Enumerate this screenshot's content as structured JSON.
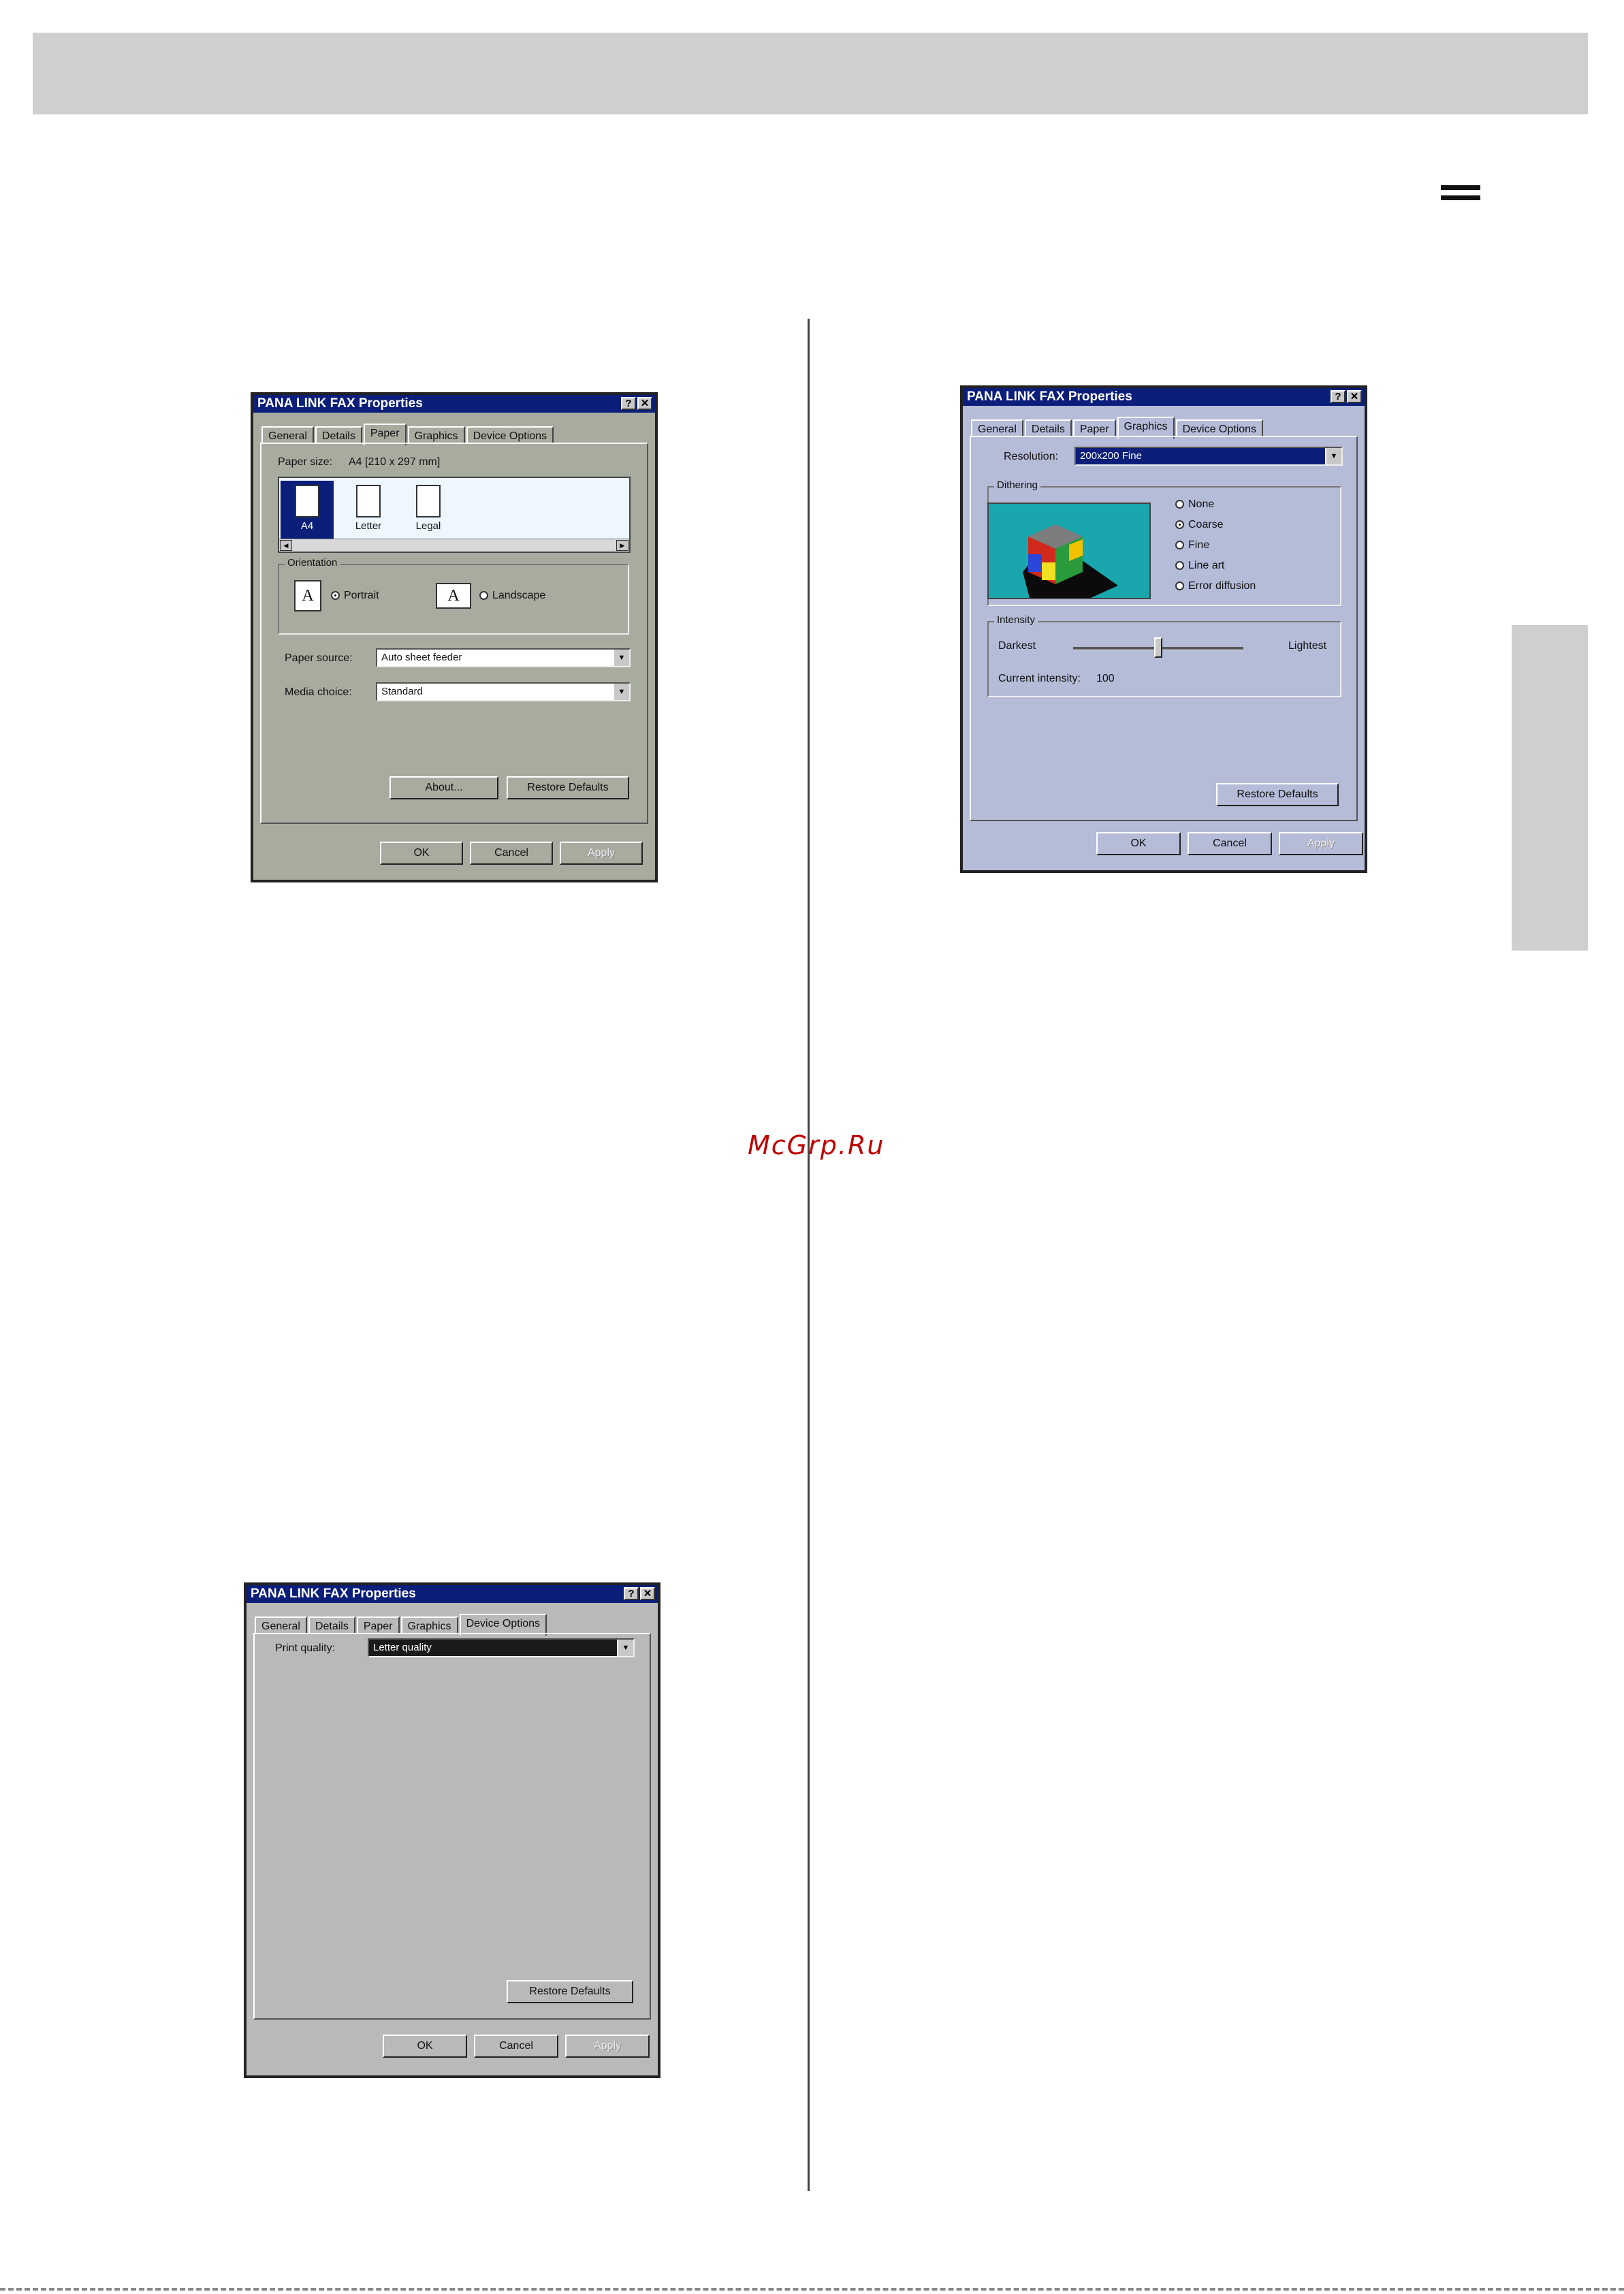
{
  "watermark": "McGrp.Ru",
  "dialog_paper": {
    "title": "PANA LINK FAX Properties",
    "help_btn": "?",
    "close_btn": "✕",
    "tabs": [
      "General",
      "Details",
      "Paper",
      "Graphics",
      "Device Options"
    ],
    "active_tab": "Paper",
    "paper_size_label": "Paper size:",
    "paper_size_value": "A4   [210 x 297 mm]",
    "paper_items": [
      "A4",
      "Letter",
      "Legal"
    ],
    "orientation_label": "Orientation",
    "orientation_portrait": "Portrait",
    "orientation_landscape": "Landscape",
    "orientation_icon_glyph": "A",
    "paper_source_label": "Paper source:",
    "paper_source_value": "Auto sheet feeder",
    "media_choice_label": "Media choice:",
    "media_choice_value": "Standard",
    "about_btn": "About...",
    "restore_btn": "Restore Defaults",
    "ok_btn": "OK",
    "cancel_btn": "Cancel",
    "apply_btn": "Apply"
  },
  "dialog_graphics": {
    "title": "PANA LINK FAX Properties",
    "help_btn": "?",
    "close_btn": "✕",
    "tabs": [
      "General",
      "Details",
      "Paper",
      "Graphics",
      "Device Options"
    ],
    "active_tab": "Graphics",
    "resolution_label": "Resolution:",
    "resolution_value": "200x200 Fine",
    "dithering_label": "Dithering",
    "dither_options": [
      "None",
      "Coarse",
      "Fine",
      "Line art",
      "Error diffusion"
    ],
    "dither_selected": "Coarse",
    "intensity_label": "Intensity",
    "darkest_label": "Darkest",
    "lightest_label": "Lightest",
    "intensity_value": 100,
    "intensity_min": 0,
    "intensity_max": 200,
    "current_intensity_label": "Current intensity:",
    "current_intensity_value": "100",
    "restore_btn": "Restore Defaults",
    "ok_btn": "OK",
    "cancel_btn": "Cancel",
    "apply_btn": "Apply"
  },
  "dialog_device": {
    "title": "PANA LINK FAX Properties",
    "help_btn": "?",
    "close_btn": "✕",
    "tabs": [
      "General",
      "Details",
      "Paper",
      "Graphics",
      "Device Options"
    ],
    "active_tab": "Device Options",
    "print_quality_label": "Print quality:",
    "print_quality_value": "Letter quality",
    "restore_btn": "Restore Defaults",
    "ok_btn": "OK",
    "cancel_btn": "Cancel",
    "apply_btn": "Apply"
  }
}
